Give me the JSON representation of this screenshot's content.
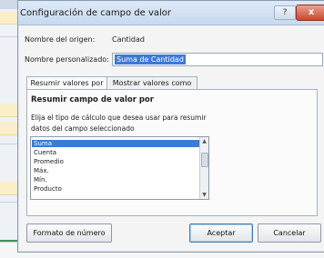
{
  "dialog": {
    "title": "Configuración de campo de valor",
    "help_label": "?",
    "close_label": "x",
    "source_label": "Nombre del origen:",
    "source_value": "Cantidad",
    "custom_name_label": "Nombre personalizado:",
    "custom_name_value": "Suma de Cantidad",
    "tabs": [
      {
        "label": "Resumir valores por",
        "active": true
      },
      {
        "label": "Mostrar valores como",
        "active": false
      }
    ],
    "section_heading": "Resumir campo de valor por",
    "description_line1": "Elija el tipo de cálculo que desea usar para resumir",
    "description_line2": "datos del campo seleccionado",
    "functions": [
      "Suma",
      "Cuenta",
      "Promedio",
      "Máx.",
      "Mín.",
      "Producto"
    ],
    "selected_function": "Suma",
    "number_format_button": "Formato de número",
    "ok_button": "Aceptar",
    "cancel_button": "Cancelar"
  },
  "colors": {
    "selection": "#3b7ad6",
    "titlebar": "#c8d9ee",
    "close": "#c9472d"
  }
}
